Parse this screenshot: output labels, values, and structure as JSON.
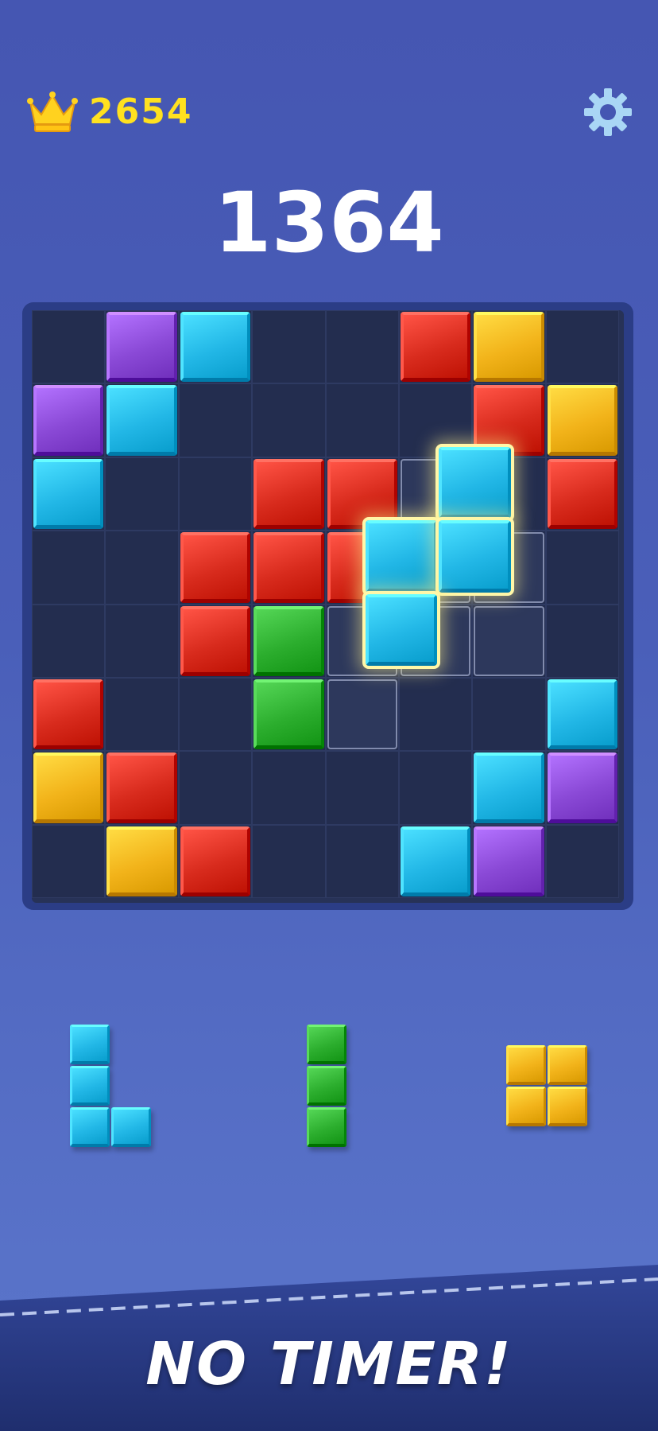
{
  "header": {
    "best_score": "2654",
    "current_score": "1364",
    "crown_icon": "crown-icon",
    "settings_icon": "gear-icon"
  },
  "colors": {
    "purple": "#8a49d6",
    "cyan": "#22b7e6",
    "red": "#d82b1d",
    "yellow": "#f2b31a",
    "green": "#2cae2e",
    "empty": "#232d4f",
    "highlight": "#fff7a8"
  },
  "board": {
    "rows": 8,
    "cols": 8,
    "grid": [
      [
        "",
        "purple",
        "cyan",
        "",
        "",
        "red",
        "yellow",
        ""
      ],
      [
        "purple",
        "cyan",
        "",
        "",
        "",
        "",
        "red",
        "yellow"
      ],
      [
        "cyan",
        "",
        "",
        "red",
        "red",
        "",
        "",
        "red"
      ],
      [
        "",
        "",
        "red",
        "red",
        "red",
        "",
        "",
        ""
      ],
      [
        "",
        "",
        "red",
        "green",
        "",
        "",
        "",
        ""
      ],
      [
        "red",
        "",
        "",
        "green",
        "",
        "",
        "",
        "cyan"
      ],
      [
        "yellow",
        "red",
        "",
        "",
        "",
        "",
        "cyan",
        "purple"
      ],
      [
        "",
        "yellow",
        "red",
        "",
        "",
        "cyan",
        "purple",
        ""
      ]
    ],
    "ghost_cells": [
      [
        2,
        5
      ],
      [
        3,
        5
      ],
      [
        3,
        6
      ],
      [
        4,
        4
      ],
      [
        4,
        5
      ],
      [
        4,
        6
      ],
      [
        5,
        4
      ]
    ],
    "dragged_piece": {
      "color": "cyan",
      "cells": [
        [
          0,
          1
        ],
        [
          1,
          0
        ],
        [
          1,
          1
        ],
        [
          2,
          0
        ]
      ]
    }
  },
  "tray": [
    {
      "name": "tray-piece-cyan-l",
      "color": "cyan",
      "cells": [
        [
          0,
          0
        ],
        [
          1,
          0
        ],
        [
          2,
          0
        ],
        [
          2,
          1
        ]
      ]
    },
    {
      "name": "tray-piece-green-i",
      "color": "green",
      "cells": [
        [
          0,
          0
        ],
        [
          1,
          0
        ],
        [
          2,
          0
        ]
      ]
    },
    {
      "name": "tray-piece-yellow-o",
      "color": "yellow",
      "cells": [
        [
          0,
          0
        ],
        [
          0,
          1
        ],
        [
          1,
          0
        ],
        [
          1,
          1
        ]
      ]
    }
  ],
  "banner": {
    "text": "NO TIMER!"
  }
}
